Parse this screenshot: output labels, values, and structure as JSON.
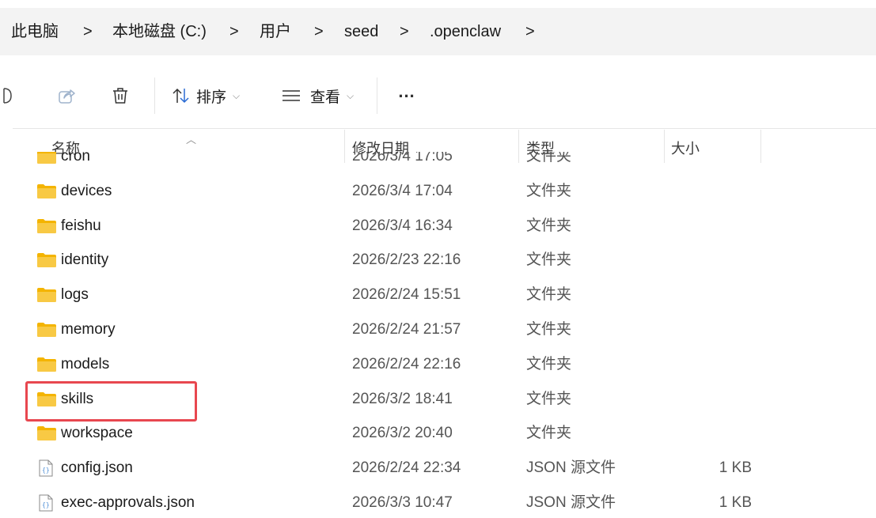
{
  "breadcrumb": {
    "items": [
      "此电脑",
      "本地磁盘 (C:)",
      "用户",
      "seed",
      ".openclaw"
    ],
    "separator": ">"
  },
  "toolbar": {
    "sort_label": "排序",
    "view_label": "查看",
    "more_label": "..."
  },
  "columns": {
    "name": "名称",
    "date": "修改日期",
    "type": "类型",
    "size": "大小"
  },
  "rows": [
    {
      "name": "cron",
      "date": "2026/3/4 17:05",
      "type": "文件夹",
      "size": "",
      "icon": "folder-icon"
    },
    {
      "name": "devices",
      "date": "2026/3/4 17:04",
      "type": "文件夹",
      "size": "",
      "icon": "folder-icon"
    },
    {
      "name": "feishu",
      "date": "2026/3/4 16:34",
      "type": "文件夹",
      "size": "",
      "icon": "folder-icon"
    },
    {
      "name": "identity",
      "date": "2026/2/23 22:16",
      "type": "文件夹",
      "size": "",
      "icon": "folder-icon"
    },
    {
      "name": "logs",
      "date": "2026/2/24 15:51",
      "type": "文件夹",
      "size": "",
      "icon": "folder-icon"
    },
    {
      "name": "memory",
      "date": "2026/2/24 21:57",
      "type": "文件夹",
      "size": "",
      "icon": "folder-icon"
    },
    {
      "name": "models",
      "date": "2026/2/24 22:16",
      "type": "文件夹",
      "size": "",
      "icon": "folder-icon"
    },
    {
      "name": "skills",
      "date": "2026/3/2 18:41",
      "type": "文件夹",
      "size": "",
      "icon": "folder-icon"
    },
    {
      "name": "workspace",
      "date": "2026/3/2 20:40",
      "type": "文件夹",
      "size": "",
      "icon": "folder-icon"
    },
    {
      "name": "config.json",
      "date": "2026/2/24 22:34",
      "type": "JSON 源文件",
      "size": "1 KB",
      "icon": "json-file-icon"
    },
    {
      "name": "exec-approvals.json",
      "date": "2026/3/3 10:47",
      "type": "JSON 源文件",
      "size": "1 KB",
      "icon": "json-file-icon"
    }
  ],
  "colors": {
    "folder": "#f8c944",
    "highlight": "#e8474f",
    "addressbar_bg": "#f3f3f3"
  }
}
